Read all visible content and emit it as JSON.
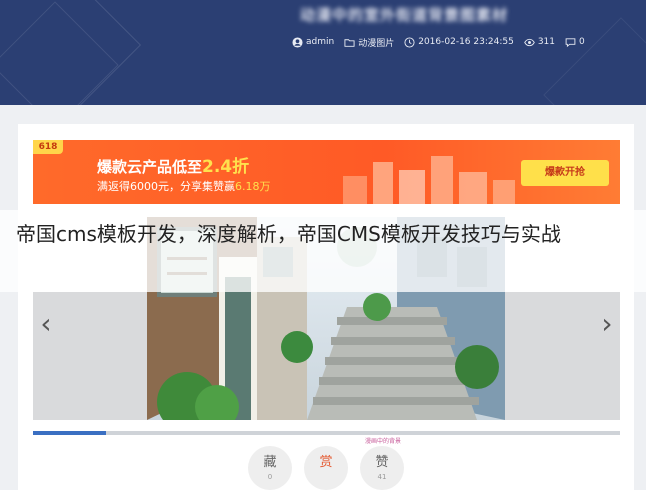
{
  "header": {
    "title": "动漫中的室外街道背景图素材",
    "meta": {
      "author": "admin",
      "category": "动漫图片",
      "datetime": "2016-02-16 23:24:55",
      "views": "311",
      "comments": "0"
    }
  },
  "banner": {
    "tag": "618",
    "headline_prefix": "爆款云产品低至",
    "headline_highlight": "2.4折",
    "sub_prefix": "满返得6000元，分享集赞赢",
    "sub_highlight": "6.18万",
    "cta": "爆款开抢",
    "colors": {
      "bg": "#ff5a26",
      "cta_bg": "#ffe04a",
      "highlight": "#ffe14d"
    }
  },
  "slider": {
    "prev": "‹",
    "next": "›",
    "credit": "漫画中的背景"
  },
  "actions": {
    "favorite": {
      "label": "藏",
      "count": "0"
    },
    "reward": {
      "label": "赏",
      "count": ""
    },
    "like": {
      "label": "赞",
      "count": "41"
    }
  },
  "overlay": {
    "text": "帝国cms模板开发，深度解析，帝国CMS模板开发技巧与实战"
  },
  "colors": {
    "header_bg": "#2b3f73",
    "progress": "#3a6fc2"
  }
}
